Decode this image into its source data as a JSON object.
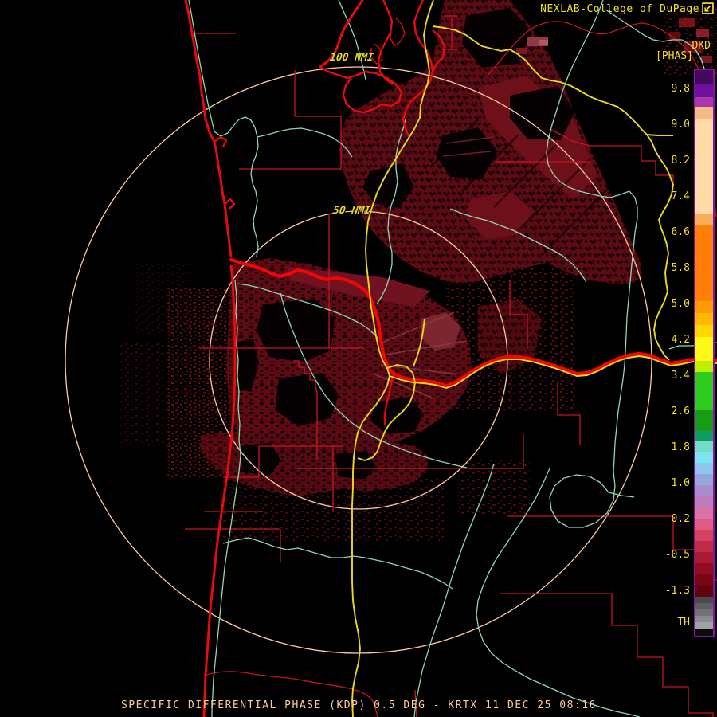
{
  "header": {
    "brand": "NEXLAB-College of DuPage",
    "brand_icon": "external-link-icon",
    "product_id": "DKD",
    "units_label": "[PHAS]"
  },
  "map": {
    "ring_label_outer": "100 NMI",
    "ring_label_inner": "50 NMI"
  },
  "colorbar": {
    "tick_labels": [
      "9.8",
      "9.0",
      "8.2",
      "7.4",
      "6.6",
      "5.8",
      "5.0",
      "4.2",
      "3.4",
      "2.6",
      "1.8",
      "1.0",
      "0.2",
      "-0.5",
      "-1.3"
    ],
    "threshold_label": "TH",
    "segments": [
      [
        "#44085e",
        18
      ],
      [
        "#6e109c",
        16
      ],
      [
        "#a838ac",
        12
      ],
      [
        "#f2bc84",
        16
      ],
      [
        "#ffd9a6",
        118
      ],
      [
        "#f6ae58",
        14
      ],
      [
        "#ff7e06",
        96
      ],
      [
        "#ff9c00",
        15
      ],
      [
        "#ffb900",
        15
      ],
      [
        "#ffd800",
        15
      ],
      [
        "#fdf816",
        30
      ],
      [
        "#bdf004",
        14
      ],
      [
        "#2ecc1e",
        48
      ],
      [
        "#189c14",
        26
      ],
      [
        "#0e9e64",
        12
      ],
      [
        "#72dcc6",
        14
      ],
      [
        "#7ee4ee",
        14
      ],
      [
        "#8ec6f0",
        14
      ],
      [
        "#94a6da",
        14
      ],
      [
        "#a88ecc",
        14
      ],
      [
        "#bf7cbc",
        14
      ],
      [
        "#d873a6",
        14
      ],
      [
        "#de5c82",
        14
      ],
      [
        "#d44462",
        14
      ],
      [
        "#c02c46",
        14
      ],
      [
        "#a81a30",
        14
      ],
      [
        "#900c20",
        14
      ],
      [
        "#780616",
        14
      ],
      [
        "#5e0410",
        14
      ],
      [
        "#4a4a4e",
        8
      ],
      [
        "#5e5e62",
        8
      ],
      [
        "#727276",
        8
      ],
      [
        "#8a8a8e",
        8
      ],
      [
        "#a2a2a6",
        8
      ],
      [
        "#0c0c0c",
        9
      ]
    ]
  },
  "caption": "SPECIFIC DIFFERENTIAL PHASE (KDP) 0.5 DEG - KRTX 11 DEC 25 08:16",
  "palette": {
    "background": "#000000",
    "echo_base": "#5c0a13",
    "echo_dark": "#060203",
    "echo_light": "#701220",
    "echo_pink": "#a04e58",
    "coastline_red": "#e80b0b",
    "county_red": "#c81424",
    "stream_green": "#8fd8b0",
    "highway_yellow": "#ecd91c",
    "ring_peach": "#ffc9a2",
    "label_yellow": "#f2df2a",
    "caption_peach": "#ffcc99",
    "colorbar_border": "#8a10a8"
  }
}
